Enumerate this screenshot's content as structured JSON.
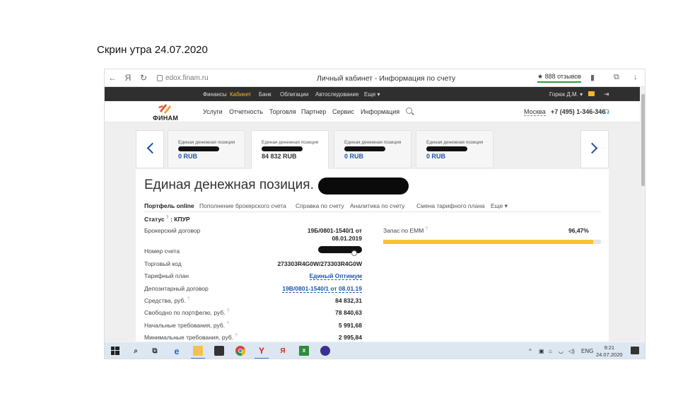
{
  "caption": "Скрин утра 24.07.2020",
  "browser": {
    "url": "edox.finam.ru",
    "title": "Личный кабинет - Информация по счету",
    "reviews": "★ 888 отзывов"
  },
  "topnav": {
    "items": [
      "Финансы",
      "Кабинет",
      "Банк",
      "Облигации",
      "Автоследование",
      "Еще ▾"
    ],
    "user": "Горюк Д.М. ▾"
  },
  "mainnav": {
    "logo": "ФИНАМ",
    "items": [
      "Услуги",
      "Отчетность",
      "Торговля",
      "Партнер",
      "Сервис",
      "Информация"
    ],
    "city": "Москва",
    "phone": "+7 (495) 1-346-346"
  },
  "cards": [
    {
      "label": "Единая денежная позиция",
      "amount": "0 RUB"
    },
    {
      "label": "Единая денежная позиция",
      "amount": "84 832 RUB"
    },
    {
      "label": "Единая денежная позиция",
      "amount": "0 RUB"
    },
    {
      "label": "Единая денежная позиция",
      "amount": "0 RUB"
    }
  ],
  "panel": {
    "title": "Единая денежная позиция.",
    "tabs": [
      "Портфель online",
      "Пополнение брокерского счета",
      "Справка по счету",
      "Аналитика по счету",
      "Смена тарифного плана",
      "Еще ▾"
    ],
    "status_label": "Статус",
    "status_value": ": КПУР",
    "rows": [
      {
        "label": "Брокерский договор",
        "value": "19Б/0801-1540/1 от",
        "value2": "08.01.2019"
      },
      {
        "label": "Номер счета",
        "value": ""
      },
      {
        "label": "Торговый код",
        "value": "273303R4G0W/273303R4G0W"
      },
      {
        "label": "Тарифный план",
        "value": "Единый Оптимум"
      },
      {
        "label": "Депозитарный договор",
        "value": "19В/0801-1540/1 от 08.01.19"
      },
      {
        "label": "Средства, руб.",
        "value": "84 832,31"
      },
      {
        "label": "Свободно по портфелю, руб.",
        "value": "78 840,63"
      },
      {
        "label": "Начальные требования, руб.",
        "value": "5 991,68"
      },
      {
        "label": "Минимальные требования, руб.",
        "value": "2 995,84"
      }
    ],
    "emm_label": "Запас по ЕММ",
    "emm_value": "96,47%",
    "emm_fraction": 0.9647,
    "emm_color": "#f4c431"
  },
  "taskbar": {
    "lang": "ENG",
    "time": "9:21",
    "date": "24.07.2020"
  }
}
